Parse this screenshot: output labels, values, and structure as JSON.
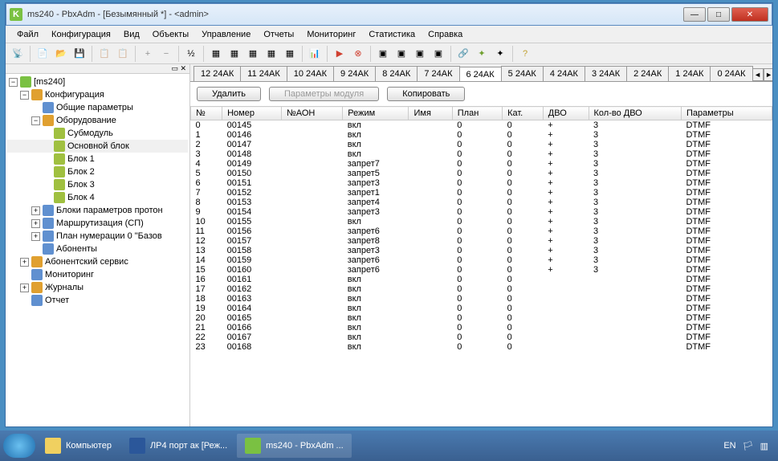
{
  "title": "ms240 - PbxAdm - [Безымянный *]  -  <admin>",
  "menu": [
    "Файл",
    "Конфигурация",
    "Вид",
    "Объекты",
    "Управление",
    "Отчеты",
    "Мониторинг",
    "Статистика",
    "Справка"
  ],
  "tree": {
    "root": "[ms240]",
    "cfg": "Конфигурация",
    "common": "Общие параметры",
    "equip": "Оборудование",
    "sub": "Субмодуль",
    "main_block": "Основной блок",
    "b1": "Блок 1",
    "b2": "Блок 2",
    "b3": "Блок 3",
    "b4": "Блок 4",
    "bpp": "Блоки параметров протон",
    "marsh": "Маршрутизация (СП)",
    "plan": "План нумерации 0 \"Базов",
    "abon": "Абоненты",
    "absrv": "Абонентский сервис",
    "mon": "Мониторинг",
    "jrn": "Журналы",
    "rep": "Отчет"
  },
  "tabs": [
    "12 24АК",
    "11 24АК",
    "10 24АК",
    "9 24АК",
    "8 24АК",
    "7 24АК",
    "6 24АК",
    "5 24АК",
    "4 24АК",
    "3 24АК",
    "2 24АК",
    "1 24АК",
    "0 24АК"
  ],
  "activeTab": 6,
  "buttons": {
    "del": "Удалить",
    "params": "Параметры модуля",
    "copy": "Копировать"
  },
  "cols": [
    "№",
    "Номер",
    "№АОН",
    "Режим",
    "Имя",
    "План",
    "Кат.",
    "ДВО",
    "Кол-во ДВО",
    "Параметры"
  ],
  "rows": [
    {
      "n": "0",
      "num": "00145",
      "aon": "",
      "mode": "вкл",
      "name": "",
      "plan": "0",
      "kat": "0",
      "dvo": "+",
      "kdvo": "3",
      "par": "DTMF"
    },
    {
      "n": "1",
      "num": "00146",
      "aon": "",
      "mode": "вкл",
      "name": "",
      "plan": "0",
      "kat": "0",
      "dvo": "+",
      "kdvo": "3",
      "par": "DTMF"
    },
    {
      "n": "2",
      "num": "00147",
      "aon": "",
      "mode": "вкл",
      "name": "",
      "plan": "0",
      "kat": "0",
      "dvo": "+",
      "kdvo": "3",
      "par": "DTMF"
    },
    {
      "n": "3",
      "num": "00148",
      "aon": "",
      "mode": "вкл",
      "name": "",
      "plan": "0",
      "kat": "0",
      "dvo": "+",
      "kdvo": "3",
      "par": "DTMF"
    },
    {
      "n": "4",
      "num": "00149",
      "aon": "",
      "mode": "запрет7",
      "name": "",
      "plan": "0",
      "kat": "0",
      "dvo": "+",
      "kdvo": "3",
      "par": "DTMF"
    },
    {
      "n": "5",
      "num": "00150",
      "aon": "",
      "mode": "запрет5",
      "name": "",
      "plan": "0",
      "kat": "0",
      "dvo": "+",
      "kdvo": "3",
      "par": "DTMF"
    },
    {
      "n": "6",
      "num": "00151",
      "aon": "",
      "mode": "запрет3",
      "name": "",
      "plan": "0",
      "kat": "0",
      "dvo": "+",
      "kdvo": "3",
      "par": "DTMF"
    },
    {
      "n": "7",
      "num": "00152",
      "aon": "",
      "mode": "запрет1",
      "name": "",
      "plan": "0",
      "kat": "0",
      "dvo": "+",
      "kdvo": "3",
      "par": "DTMF"
    },
    {
      "n": "8",
      "num": "00153",
      "aon": "",
      "mode": "запрет4",
      "name": "",
      "plan": "0",
      "kat": "0",
      "dvo": "+",
      "kdvo": "3",
      "par": "DTMF"
    },
    {
      "n": "9",
      "num": "00154",
      "aon": "",
      "mode": "запрет3",
      "name": "",
      "plan": "0",
      "kat": "0",
      "dvo": "+",
      "kdvo": "3",
      "par": "DTMF"
    },
    {
      "n": "10",
      "num": "00155",
      "aon": "",
      "mode": "вкл",
      "name": "",
      "plan": "0",
      "kat": "0",
      "dvo": "+",
      "kdvo": "3",
      "par": "DTMF"
    },
    {
      "n": "11",
      "num": "00156",
      "aon": "",
      "mode": "запрет6",
      "name": "",
      "plan": "0",
      "kat": "0",
      "dvo": "+",
      "kdvo": "3",
      "par": "DTMF"
    },
    {
      "n": "12",
      "num": "00157",
      "aon": "",
      "mode": "запрет8",
      "name": "",
      "plan": "0",
      "kat": "0",
      "dvo": "+",
      "kdvo": "3",
      "par": "DTMF"
    },
    {
      "n": "13",
      "num": "00158",
      "aon": "",
      "mode": "запрет3",
      "name": "",
      "plan": "0",
      "kat": "0",
      "dvo": "+",
      "kdvo": "3",
      "par": "DTMF"
    },
    {
      "n": "14",
      "num": "00159",
      "aon": "",
      "mode": "запрет6",
      "name": "",
      "plan": "0",
      "kat": "0",
      "dvo": "+",
      "kdvo": "3",
      "par": "DTMF"
    },
    {
      "n": "15",
      "num": "00160",
      "aon": "",
      "mode": "запрет6",
      "name": "",
      "plan": "0",
      "kat": "0",
      "dvo": "+",
      "kdvo": "3",
      "par": "DTMF"
    },
    {
      "n": "16",
      "num": "00161",
      "aon": "",
      "mode": "вкл",
      "name": "",
      "plan": "0",
      "kat": "0",
      "dvo": "",
      "kdvo": "",
      "par": "DTMF"
    },
    {
      "n": "17",
      "num": "00162",
      "aon": "",
      "mode": "вкл",
      "name": "",
      "plan": "0",
      "kat": "0",
      "dvo": "",
      "kdvo": "",
      "par": "DTMF"
    },
    {
      "n": "18",
      "num": "00163",
      "aon": "",
      "mode": "вкл",
      "name": "",
      "plan": "0",
      "kat": "0",
      "dvo": "",
      "kdvo": "",
      "par": "DTMF"
    },
    {
      "n": "19",
      "num": "00164",
      "aon": "",
      "mode": "вкл",
      "name": "",
      "plan": "0",
      "kat": "0",
      "dvo": "",
      "kdvo": "",
      "par": "DTMF"
    },
    {
      "n": "20",
      "num": "00165",
      "aon": "",
      "mode": "вкл",
      "name": "",
      "plan": "0",
      "kat": "0",
      "dvo": "",
      "kdvo": "",
      "par": "DTMF"
    },
    {
      "n": "21",
      "num": "00166",
      "aon": "",
      "mode": "вкл",
      "name": "",
      "plan": "0",
      "kat": "0",
      "dvo": "",
      "kdvo": "",
      "par": "DTMF"
    },
    {
      "n": "22",
      "num": "00167",
      "aon": "",
      "mode": "вкл",
      "name": "",
      "plan": "0",
      "kat": "0",
      "dvo": "",
      "kdvo": "",
      "par": "DTMF"
    },
    {
      "n": "23",
      "num": "00168",
      "aon": "",
      "mode": "вкл",
      "name": "",
      "plan": "0",
      "kat": "0",
      "dvo": "",
      "kdvo": "",
      "par": "DTMF"
    }
  ],
  "taskbar": {
    "t1": "Компьютер",
    "t2": "ЛР4 порт ак [Реж...",
    "t3": "ms240 - PbxAdm ...",
    "lang": "EN"
  }
}
